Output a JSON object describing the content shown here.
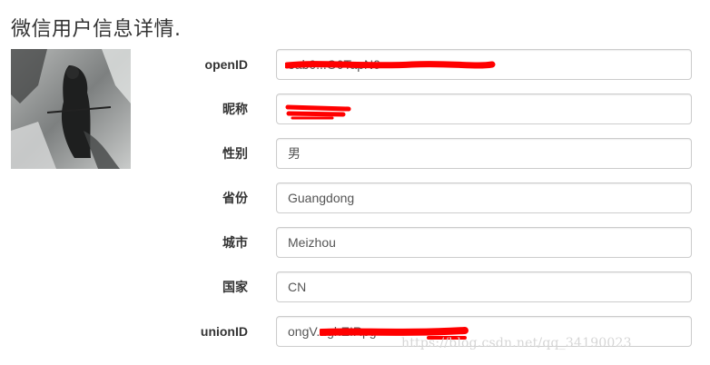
{
  "page": {
    "title": "微信用户信息详情."
  },
  "fields": [
    {
      "label": "openID",
      "value": "oab0...O0TapN0"
    },
    {
      "label": "昵称",
      "value": ""
    },
    {
      "label": "性别",
      "value": "男"
    },
    {
      "label": "省份",
      "value": "Guangdong"
    },
    {
      "label": "城市",
      "value": "Meizhou"
    },
    {
      "label": "国家",
      "value": "CN"
    },
    {
      "label": "unionID",
      "value": "ongV...ghEIRpg"
    }
  ],
  "watermark": "https://blog.csdn.net/qq_34190023",
  "colors": {
    "redaction": "#ff0000",
    "input_border": "#cccccc",
    "watermark": "#d6d6d6"
  }
}
